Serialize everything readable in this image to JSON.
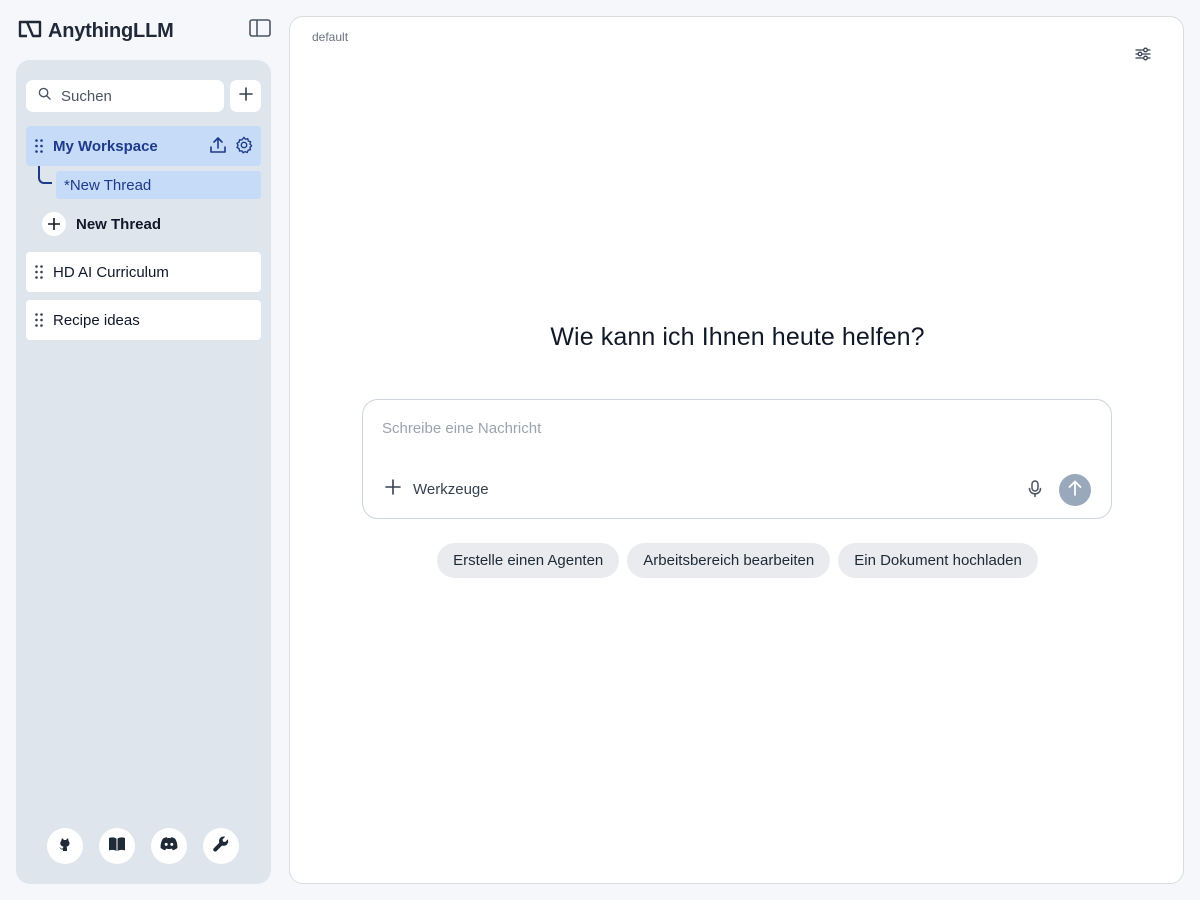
{
  "app": {
    "name": "AnythingLLM",
    "logo_icon": "anything-logo-icon",
    "toggle_icon": "sidebar-toggle-icon"
  },
  "colors": {
    "sidebar_bg": "#dfe5ed",
    "active_bg": "#c5dbf7",
    "active_text": "#1e3a8a",
    "send_button": "#9aa8bb",
    "chip_bg": "#e9ebee"
  },
  "sidebar": {
    "search": {
      "placeholder": "Suchen",
      "value": ""
    },
    "workspaces": [
      {
        "label": "My Workspace",
        "active": true,
        "threads": [
          {
            "label": "*New Thread",
            "active": true
          }
        ],
        "new_thread_label": "New Thread"
      },
      {
        "label": "HD AI Curriculum",
        "active": false
      },
      {
        "label": "Recipe ideas",
        "active": false
      }
    ],
    "footer_icons": [
      "github-icon",
      "book-icon",
      "discord-icon",
      "wrench-icon"
    ]
  },
  "main": {
    "model_label": "default",
    "greeting": "Wie kann ich Ihnen heute helfen?",
    "composer": {
      "placeholder": "Schreibe eine Nachricht",
      "value": "",
      "tools_label": "Werkzeuge"
    },
    "suggestions": [
      "Erstelle einen Agenten",
      "Arbeitsbereich bearbeiten",
      "Ein Dokument hochladen"
    ]
  }
}
